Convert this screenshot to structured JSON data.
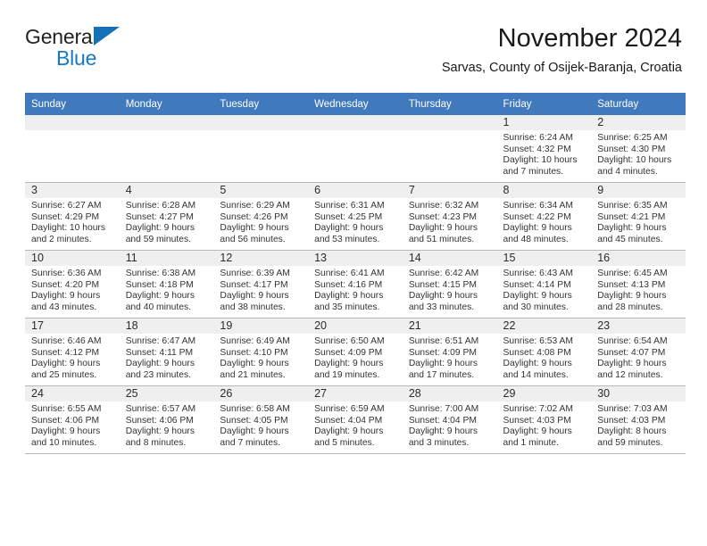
{
  "brand": {
    "name_top": "General",
    "name_bottom": "Blue",
    "accent_color": "#1779c4",
    "triangle_color": "#1471b8"
  },
  "header": {
    "month_title": "November 2024",
    "location": "Sarvas, County of Osijek-Baranja, Croatia"
  },
  "theme": {
    "header_blue": "#4179bd",
    "daynum_band": "#efefef",
    "grid_line": "#b9b9b9"
  },
  "weekday_headers": [
    "Sunday",
    "Monday",
    "Tuesday",
    "Wednesday",
    "Thursday",
    "Friday",
    "Saturday"
  ],
  "weeks": [
    [
      {
        "day": "",
        "empty": true,
        "sunrise": "",
        "sunset": "",
        "daylight1": "",
        "daylight2": ""
      },
      {
        "day": "",
        "empty": true,
        "sunrise": "",
        "sunset": "",
        "daylight1": "",
        "daylight2": ""
      },
      {
        "day": "",
        "empty": true,
        "sunrise": "",
        "sunset": "",
        "daylight1": "",
        "daylight2": ""
      },
      {
        "day": "",
        "empty": true,
        "sunrise": "",
        "sunset": "",
        "daylight1": "",
        "daylight2": ""
      },
      {
        "day": "",
        "empty": true,
        "sunrise": "",
        "sunset": "",
        "daylight1": "",
        "daylight2": ""
      },
      {
        "day": "1",
        "empty": false,
        "sunrise": "Sunrise: 6:24 AM",
        "sunset": "Sunset: 4:32 PM",
        "daylight1": "Daylight: 10 hours",
        "daylight2": "and 7 minutes."
      },
      {
        "day": "2",
        "empty": false,
        "sunrise": "Sunrise: 6:25 AM",
        "sunset": "Sunset: 4:30 PM",
        "daylight1": "Daylight: 10 hours",
        "daylight2": "and 4 minutes."
      }
    ],
    [
      {
        "day": "3",
        "empty": false,
        "sunrise": "Sunrise: 6:27 AM",
        "sunset": "Sunset: 4:29 PM",
        "daylight1": "Daylight: 10 hours",
        "daylight2": "and 2 minutes."
      },
      {
        "day": "4",
        "empty": false,
        "sunrise": "Sunrise: 6:28 AM",
        "sunset": "Sunset: 4:27 PM",
        "daylight1": "Daylight: 9 hours",
        "daylight2": "and 59 minutes."
      },
      {
        "day": "5",
        "empty": false,
        "sunrise": "Sunrise: 6:29 AM",
        "sunset": "Sunset: 4:26 PM",
        "daylight1": "Daylight: 9 hours",
        "daylight2": "and 56 minutes."
      },
      {
        "day": "6",
        "empty": false,
        "sunrise": "Sunrise: 6:31 AM",
        "sunset": "Sunset: 4:25 PM",
        "daylight1": "Daylight: 9 hours",
        "daylight2": "and 53 minutes."
      },
      {
        "day": "7",
        "empty": false,
        "sunrise": "Sunrise: 6:32 AM",
        "sunset": "Sunset: 4:23 PM",
        "daylight1": "Daylight: 9 hours",
        "daylight2": "and 51 minutes."
      },
      {
        "day": "8",
        "empty": false,
        "sunrise": "Sunrise: 6:34 AM",
        "sunset": "Sunset: 4:22 PM",
        "daylight1": "Daylight: 9 hours",
        "daylight2": "and 48 minutes."
      },
      {
        "day": "9",
        "empty": false,
        "sunrise": "Sunrise: 6:35 AM",
        "sunset": "Sunset: 4:21 PM",
        "daylight1": "Daylight: 9 hours",
        "daylight2": "and 45 minutes."
      }
    ],
    [
      {
        "day": "10",
        "empty": false,
        "sunrise": "Sunrise: 6:36 AM",
        "sunset": "Sunset: 4:20 PM",
        "daylight1": "Daylight: 9 hours",
        "daylight2": "and 43 minutes."
      },
      {
        "day": "11",
        "empty": false,
        "sunrise": "Sunrise: 6:38 AM",
        "sunset": "Sunset: 4:18 PM",
        "daylight1": "Daylight: 9 hours",
        "daylight2": "and 40 minutes."
      },
      {
        "day": "12",
        "empty": false,
        "sunrise": "Sunrise: 6:39 AM",
        "sunset": "Sunset: 4:17 PM",
        "daylight1": "Daylight: 9 hours",
        "daylight2": "and 38 minutes."
      },
      {
        "day": "13",
        "empty": false,
        "sunrise": "Sunrise: 6:41 AM",
        "sunset": "Sunset: 4:16 PM",
        "daylight1": "Daylight: 9 hours",
        "daylight2": "and 35 minutes."
      },
      {
        "day": "14",
        "empty": false,
        "sunrise": "Sunrise: 6:42 AM",
        "sunset": "Sunset: 4:15 PM",
        "daylight1": "Daylight: 9 hours",
        "daylight2": "and 33 minutes."
      },
      {
        "day": "15",
        "empty": false,
        "sunrise": "Sunrise: 6:43 AM",
        "sunset": "Sunset: 4:14 PM",
        "daylight1": "Daylight: 9 hours",
        "daylight2": "and 30 minutes."
      },
      {
        "day": "16",
        "empty": false,
        "sunrise": "Sunrise: 6:45 AM",
        "sunset": "Sunset: 4:13 PM",
        "daylight1": "Daylight: 9 hours",
        "daylight2": "and 28 minutes."
      }
    ],
    [
      {
        "day": "17",
        "empty": false,
        "sunrise": "Sunrise: 6:46 AM",
        "sunset": "Sunset: 4:12 PM",
        "daylight1": "Daylight: 9 hours",
        "daylight2": "and 25 minutes."
      },
      {
        "day": "18",
        "empty": false,
        "sunrise": "Sunrise: 6:47 AM",
        "sunset": "Sunset: 4:11 PM",
        "daylight1": "Daylight: 9 hours",
        "daylight2": "and 23 minutes."
      },
      {
        "day": "19",
        "empty": false,
        "sunrise": "Sunrise: 6:49 AM",
        "sunset": "Sunset: 4:10 PM",
        "daylight1": "Daylight: 9 hours",
        "daylight2": "and 21 minutes."
      },
      {
        "day": "20",
        "empty": false,
        "sunrise": "Sunrise: 6:50 AM",
        "sunset": "Sunset: 4:09 PM",
        "daylight1": "Daylight: 9 hours",
        "daylight2": "and 19 minutes."
      },
      {
        "day": "21",
        "empty": false,
        "sunrise": "Sunrise: 6:51 AM",
        "sunset": "Sunset: 4:09 PM",
        "daylight1": "Daylight: 9 hours",
        "daylight2": "and 17 minutes."
      },
      {
        "day": "22",
        "empty": false,
        "sunrise": "Sunrise: 6:53 AM",
        "sunset": "Sunset: 4:08 PM",
        "daylight1": "Daylight: 9 hours",
        "daylight2": "and 14 minutes."
      },
      {
        "day": "23",
        "empty": false,
        "sunrise": "Sunrise: 6:54 AM",
        "sunset": "Sunset: 4:07 PM",
        "daylight1": "Daylight: 9 hours",
        "daylight2": "and 12 minutes."
      }
    ],
    [
      {
        "day": "24",
        "empty": false,
        "sunrise": "Sunrise: 6:55 AM",
        "sunset": "Sunset: 4:06 PM",
        "daylight1": "Daylight: 9 hours",
        "daylight2": "and 10 minutes."
      },
      {
        "day": "25",
        "empty": false,
        "sunrise": "Sunrise: 6:57 AM",
        "sunset": "Sunset: 4:06 PM",
        "daylight1": "Daylight: 9 hours",
        "daylight2": "and 8 minutes."
      },
      {
        "day": "26",
        "empty": false,
        "sunrise": "Sunrise: 6:58 AM",
        "sunset": "Sunset: 4:05 PM",
        "daylight1": "Daylight: 9 hours",
        "daylight2": "and 7 minutes."
      },
      {
        "day": "27",
        "empty": false,
        "sunrise": "Sunrise: 6:59 AM",
        "sunset": "Sunset: 4:04 PM",
        "daylight1": "Daylight: 9 hours",
        "daylight2": "and 5 minutes."
      },
      {
        "day": "28",
        "empty": false,
        "sunrise": "Sunrise: 7:00 AM",
        "sunset": "Sunset: 4:04 PM",
        "daylight1": "Daylight: 9 hours",
        "daylight2": "and 3 minutes."
      },
      {
        "day": "29",
        "empty": false,
        "sunrise": "Sunrise: 7:02 AM",
        "sunset": "Sunset: 4:03 PM",
        "daylight1": "Daylight: 9 hours",
        "daylight2": "and 1 minute."
      },
      {
        "day": "30",
        "empty": false,
        "sunrise": "Sunrise: 7:03 AM",
        "sunset": "Sunset: 4:03 PM",
        "daylight1": "Daylight: 8 hours",
        "daylight2": "and 59 minutes."
      }
    ]
  ]
}
